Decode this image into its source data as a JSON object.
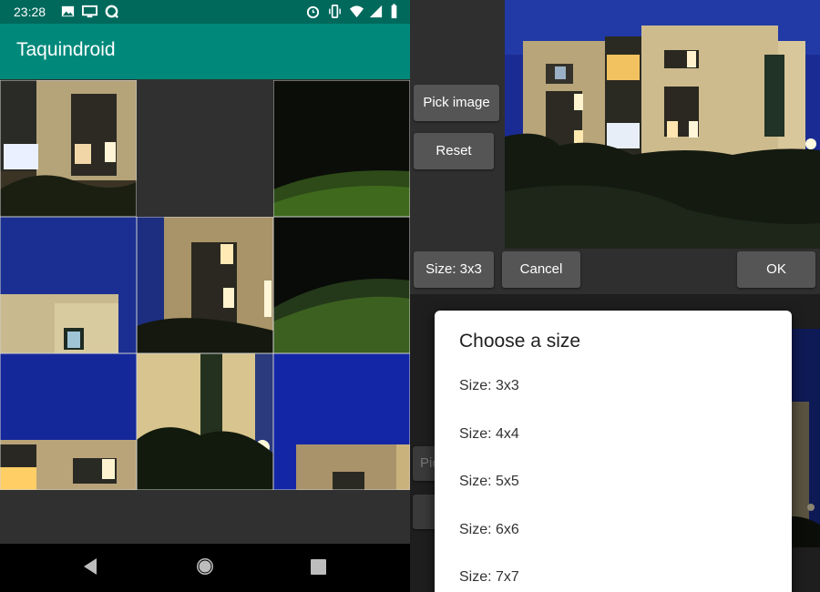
{
  "status_bar": {
    "time": "23:28",
    "left_icons": [
      "image-icon",
      "cast-icon",
      "sync-icon"
    ],
    "right_icons": [
      "alarm-icon",
      "vibrate-icon",
      "wifi-icon",
      "signal-icon",
      "battery-icon"
    ]
  },
  "app_bar": {
    "title": "Taquindroid"
  },
  "puzzle": {
    "grid_size": "3x3",
    "tiles": [
      "tile-1",
      "empty-slot",
      "tile-2",
      "tile-3",
      "tile-4",
      "tile-5",
      "tile-6",
      "tile-7",
      "tile-8"
    ]
  },
  "nav_bar": {
    "icons": [
      "back-icon",
      "home-icon",
      "recents-icon"
    ]
  },
  "side_panel": {
    "pick_image_label": "Pick image",
    "reset_label": "Reset",
    "size_label": "Size: 3x3",
    "cancel_label": "Cancel",
    "ok_label": "OK"
  },
  "size_dialog": {
    "title": "Choose a size",
    "options": [
      "Size: 3x3",
      "Size: 4x4",
      "Size: 5x5",
      "Size: 6x6",
      "Size: 7x7"
    ]
  },
  "background_ghost": {
    "label": "Pic"
  },
  "colors": {
    "status_bar": "#00695c",
    "app_bar": "#00897b",
    "sky": "#1c2f8c",
    "button": "#555555",
    "dialog": "#ffffff"
  }
}
